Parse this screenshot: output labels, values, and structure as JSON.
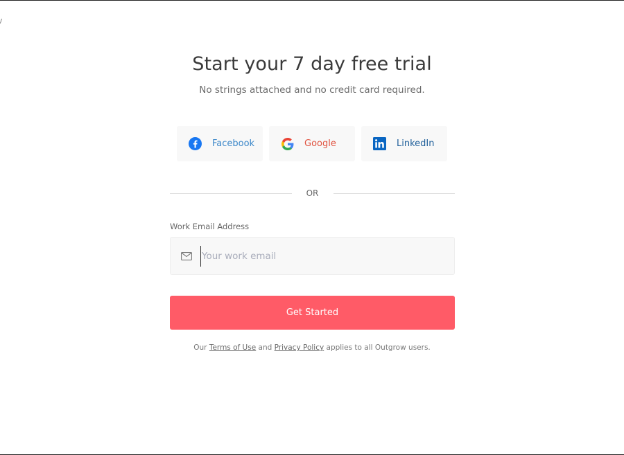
{
  "corner_mark": "/",
  "header": {
    "title": "Start your 7 day free trial",
    "subtitle": "No strings attached and no credit card required."
  },
  "social_signin": [
    {
      "label": "Facebook",
      "icon": "facebook-icon",
      "color": "#3b87c9"
    },
    {
      "label": "Google",
      "icon": "google-icon",
      "color": "#e0523f"
    },
    {
      "label": "LinkedIn",
      "icon": "linkedin-icon",
      "color": "#1f5f9a"
    }
  ],
  "divider": {
    "text": "OR"
  },
  "email": {
    "label": "Work Email Address",
    "placeholder": "Your work email",
    "value": "",
    "icon": "mail-icon"
  },
  "cta": {
    "label": "Get Started",
    "color": "#ff5b67"
  },
  "terms": {
    "prefix": "Our",
    "terms_link": "Terms of Use",
    "conjunction": "and",
    "privacy_link": "Privacy Policy",
    "suffix": "applies to all Outgrow users."
  }
}
